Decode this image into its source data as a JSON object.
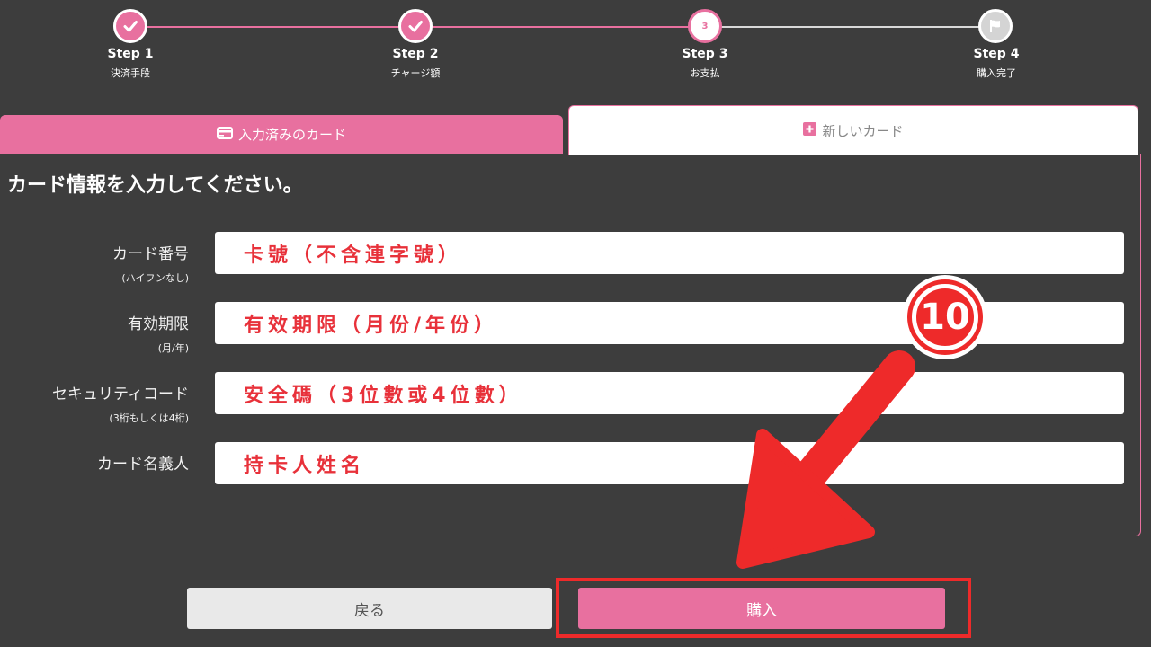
{
  "stepper": {
    "steps": [
      {
        "title": "Step 1",
        "sub": "決済手段",
        "state": "done"
      },
      {
        "title": "Step 2",
        "sub": "チャージ額",
        "state": "done"
      },
      {
        "title": "Step 3",
        "sub": "お支払",
        "state": "current",
        "number": "3"
      },
      {
        "title": "Step 4",
        "sub": "購入完了",
        "state": "todo"
      }
    ]
  },
  "tabs": {
    "saved_card": {
      "label": "入力済みのカード",
      "icon": "credit-card-icon"
    },
    "new_card": {
      "label": "新しいカード",
      "icon": "plus-square-icon"
    }
  },
  "form": {
    "heading": "カード情報を入力してください。",
    "fields": [
      {
        "label": "カード番号",
        "sub": "(ハイフンなし)",
        "value": "卡號（不含連字號）"
      },
      {
        "label": "有効期限",
        "sub": "(月/年)",
        "value": "有效期限（月份/年份）"
      },
      {
        "label": "セキュリティコード",
        "sub": "(3桁もしくは4桁)",
        "value": "安全碼（3位數或4位數）"
      },
      {
        "label": "カード名義人",
        "sub": "",
        "value": "持卡人姓名"
      }
    ]
  },
  "buttons": {
    "back_label": "戻る",
    "buy_label": "購入"
  },
  "annotation": {
    "step_number": "10",
    "color": "#ee2a2a"
  },
  "colors": {
    "accent": "#e8709f",
    "background": "#3d3d3d",
    "annotation": "#ee2a2a"
  }
}
